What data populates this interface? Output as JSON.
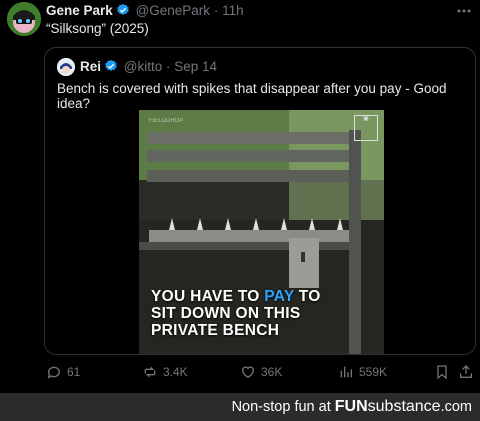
{
  "tweet": {
    "author_name": "Gene Park",
    "author_handle": "@GenePark",
    "separator": "·",
    "time": "11h",
    "text": "“Silksong” (2025)",
    "more_icon": "more-horizontal-icon"
  },
  "quote": {
    "author_name": "Rei",
    "author_handle": "@kitto",
    "separator": "·",
    "time": "Sep 14",
    "text": "Bench is covered with spikes that disappear after you pay - Good idea?",
    "media": {
      "caption_part1": "YOU HAVE TO ",
      "caption_highlight": "PAY",
      "caption_part2": " TO",
      "caption_line2": "SIT DOWN ON THIS",
      "caption_line3": "PRIVATE BENCH",
      "watermark": "FIELDDROP",
      "highlight_color": "#2ea3ff"
    }
  },
  "actions": {
    "replies": "61",
    "reposts": "3.4K",
    "likes": "36K",
    "views": "559K"
  },
  "footer": {
    "text": "Non-stop fun at ",
    "brand_bold": "FUN",
    "brand_rest": "substance",
    "brand_tld": ".com"
  },
  "colors": {
    "background": "#000000",
    "verified": "#1d9bf0",
    "muted": "#71767b",
    "border": "#2f3336",
    "footer_bg": "#2b2b2b"
  }
}
